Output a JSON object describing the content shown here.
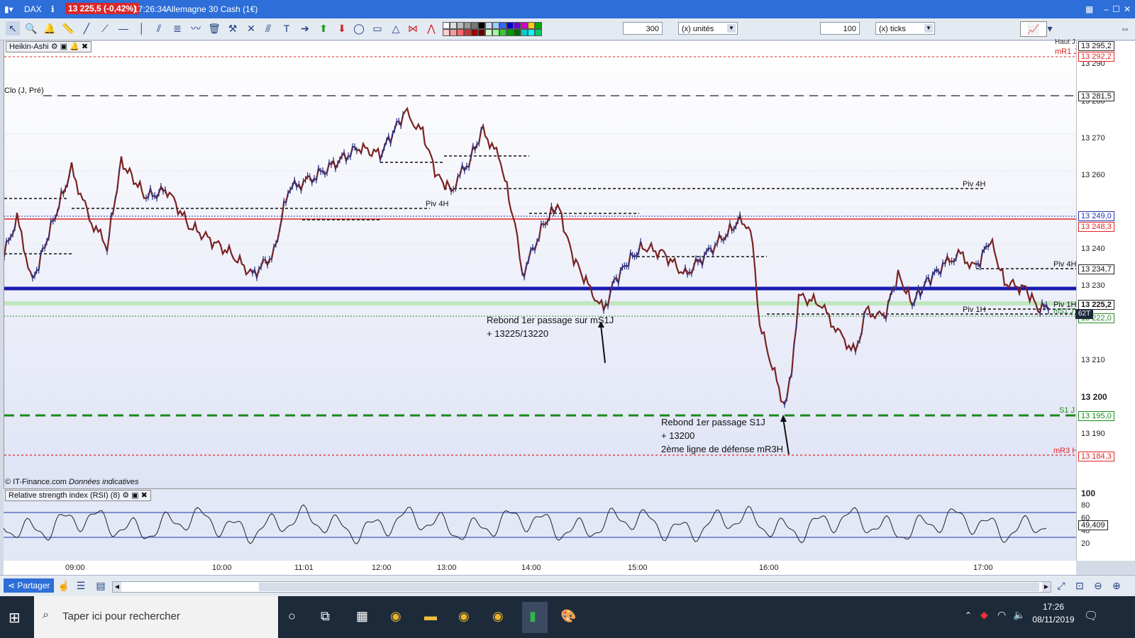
{
  "window": {
    "instrument": "DAX",
    "price_change": "13 225,5 (-0,42%)",
    "time": "17:26:34",
    "name": "Allemagne 30 Cash (1€)"
  },
  "toolbar": {
    "units_value": "300",
    "units_label": "(x) unités",
    "ticks_value": "100",
    "ticks_label": "(x) ticks"
  },
  "chart": {
    "study_label": "Heikin-Ashi",
    "clo_label": "Clo (J, Pré)",
    "copyright": "© IT-Finance.com",
    "disclaimer": "Données indicatives",
    "annotations": [
      {
        "line1": "Rebond 1er passage sur mS1J",
        "line2": "+ 13225/13220"
      },
      {
        "line1": "Rebond 1er passage S1J",
        "line2": "+ 13200",
        "line3": "2ème ligne de défense mR3H"
      }
    ],
    "level_labels": {
      "piv4h_a": "Piv 4H",
      "piv4h_b": "Piv 4H",
      "piv4h_c": "Piv 4H",
      "piv1h_a": "Piv 1H",
      "piv1h_b": "Piv 1H",
      "mr1j": "mR1 J",
      "s1j": "S1 J",
      "mr3h": "mR3 H",
      "haut": "Haut J",
      "ms1j": "mS1 J"
    }
  },
  "yaxis": {
    "ticks": [
      "13 290",
      "13 280",
      "13 270",
      "13 260",
      "13 240",
      "13 230",
      "13 210",
      "13 200",
      "13 190"
    ],
    "boxes": {
      "haut": "13 295,2",
      "mr1": "13 292,2",
      "clo": "13 281,5",
      "piv4h_top": "13 249,0",
      "red": "13 248,3",
      "piv4h": "13 234,7",
      "current": "13 225,2",
      "ms1j": "13 222,0",
      "s1j": "13 195,0",
      "mr3h": "13 184,3",
      "counter": "62T"
    },
    "rsi_ticks": [
      "100",
      "80",
      "60",
      "40",
      "20"
    ],
    "rsi_value": "49,409"
  },
  "rsi": {
    "label": "Relative strength index (RSI) (8)"
  },
  "xaxis": {
    "labels": [
      "09:00",
      "10:00",
      "11:01",
      "12:00",
      "13:00",
      "14:00",
      "15:00",
      "16:00",
      "17:00"
    ]
  },
  "bottombar": {
    "share_label": "Partager"
  },
  "taskbar": {
    "search_placeholder": "Taper ici pour rechercher",
    "clock_time": "17:26",
    "clock_date": "08/11/2019"
  },
  "colors": {
    "titlebar": "#2d6ed8",
    "red_level": "#e02424",
    "blue_level": "#1a1ab0",
    "green_level": "#1a8a1a"
  }
}
